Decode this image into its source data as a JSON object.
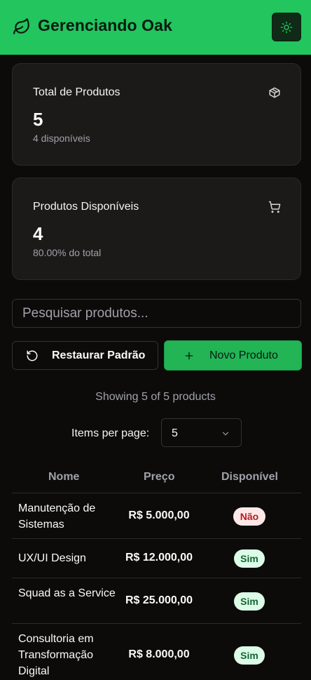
{
  "header": {
    "title": "Gerenciando Oak",
    "brand_icon": "leaf-icon",
    "theme_icon": "sun-icon",
    "accent": "#22c55e"
  },
  "stats": [
    {
      "title": "Total de Produtos",
      "value": "5",
      "sub": "4 disponíveis",
      "icon": "package-icon"
    },
    {
      "title": "Produtos Disponíveis",
      "value": "4",
      "sub": "80.00% do total",
      "icon": "cart-icon"
    }
  ],
  "search": {
    "placeholder": "Pesquisar produtos..."
  },
  "actions": {
    "restore_label": "Restaurar Padrão",
    "new_label": "Novo Produto"
  },
  "pagination": {
    "showing": "Showing 5 of 5 products",
    "items_label": "Items per page:",
    "items_value": "5"
  },
  "table": {
    "headers": [
      "Nome",
      "Preço",
      "Disponível"
    ],
    "rows": [
      {
        "name": "Manutenção de Sistemas",
        "price": "R$ 5.000,00",
        "available": "Não"
      },
      {
        "name": "UX/UI Design",
        "price": "R$ 12.000,00",
        "available": "Sim"
      },
      {
        "name": "Squad as a Service",
        "price": "R$ 25.000,00",
        "available": "Sim"
      },
      {
        "name": "Consultoria em Transformação Digital",
        "price": "R$ 8.000,00",
        "available": "Sim"
      }
    ]
  }
}
